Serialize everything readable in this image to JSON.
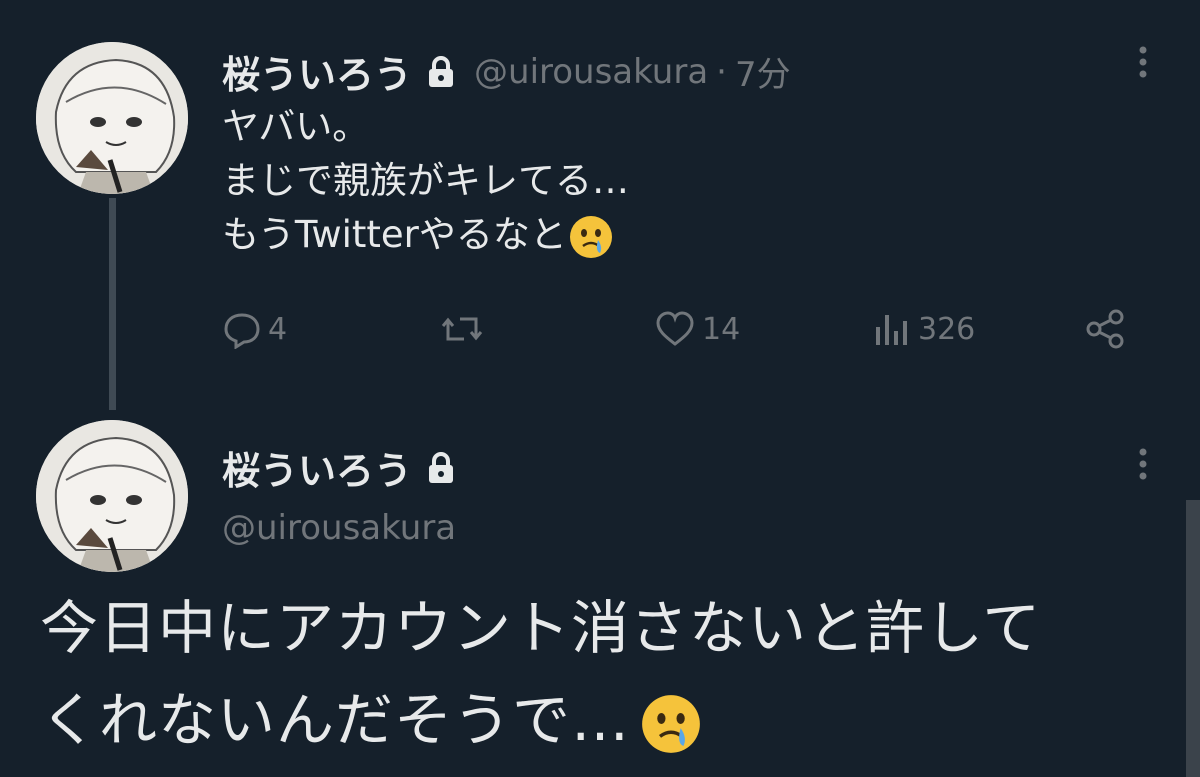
{
  "tweet1": {
    "display_name": "桜ういろう",
    "handle": "@uirousakura",
    "dot": "·",
    "time": "7分",
    "text_lines": [
      "ヤバい。",
      "まじで親族がキレてる…",
      "もうTwitterやるなと"
    ],
    "actions": {
      "replies": "4",
      "likes": "14",
      "views": "326"
    }
  },
  "tweet2": {
    "display_name": "桜ういろう",
    "handle": "@uirousakura",
    "text_lines": [
      "今日中にアカウント消さないと許して",
      "くれないんだそうで…"
    ]
  },
  "icons": {
    "lock": "lock-icon",
    "more": "more-vertical-icon",
    "reply": "reply-icon",
    "retweet": "retweet-icon",
    "like": "heart-icon",
    "views": "views-icon",
    "share": "share-icon",
    "emoji": "face-holding-back-tears-emoji"
  },
  "colors": {
    "background": "#15202b",
    "text": "#e7e9ea",
    "secondary": "#71767b",
    "emoji": "#f5c33b"
  }
}
